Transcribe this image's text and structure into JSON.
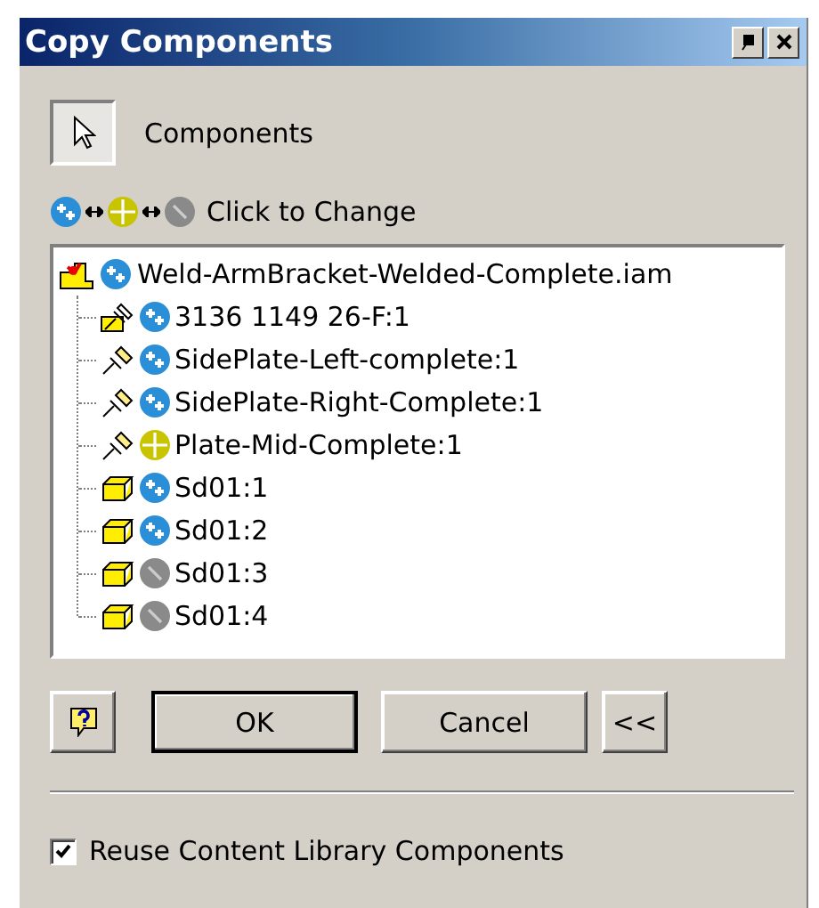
{
  "window": {
    "title": "Copy Components"
  },
  "select_button": {
    "label": "Components",
    "pressed": true
  },
  "legend": {
    "label": "Click to Change",
    "states": [
      {
        "kind": "copy"
      },
      {
        "kind": "reuse"
      },
      {
        "kind": "exclude"
      }
    ]
  },
  "tree": {
    "root": {
      "label": "Weld-ArmBracket-Welded-Complete.iam",
      "kind": "assembly",
      "status": {
        "kind": "copy"
      },
      "children": [
        {
          "label": "3136 1149 26-F:1",
          "kind": "pinned-assembly",
          "status": {
            "kind": "copy"
          }
        },
        {
          "label": "SidePlate-Left-complete:1",
          "kind": "pinned",
          "status": {
            "kind": "copy"
          }
        },
        {
          "label": "SidePlate-Right-Complete:1",
          "kind": "pinned",
          "status": {
            "kind": "copy"
          }
        },
        {
          "label": "Plate-Mid-Complete:1",
          "kind": "pinned",
          "status": {
            "kind": "reuse"
          }
        },
        {
          "label": "Sd01:1",
          "kind": "part",
          "status": {
            "kind": "copy"
          }
        },
        {
          "label": "Sd01:2",
          "kind": "part",
          "status": {
            "kind": "copy"
          }
        },
        {
          "label": "Sd01:3",
          "kind": "part",
          "status": {
            "kind": "exclude"
          }
        },
        {
          "label": "Sd01:4",
          "kind": "part",
          "status": {
            "kind": "exclude"
          }
        }
      ]
    }
  },
  "buttons": [
    {
      "kind": "help"
    },
    {
      "kind": "text",
      "label": "OK",
      "default": true
    },
    {
      "kind": "text",
      "label": "Cancel",
      "default": false
    },
    {
      "kind": "text",
      "label": "<<",
      "default": false
    }
  ],
  "reuse_checkbox": {
    "label": "Reuse Content Library Components",
    "checked": true
  }
}
